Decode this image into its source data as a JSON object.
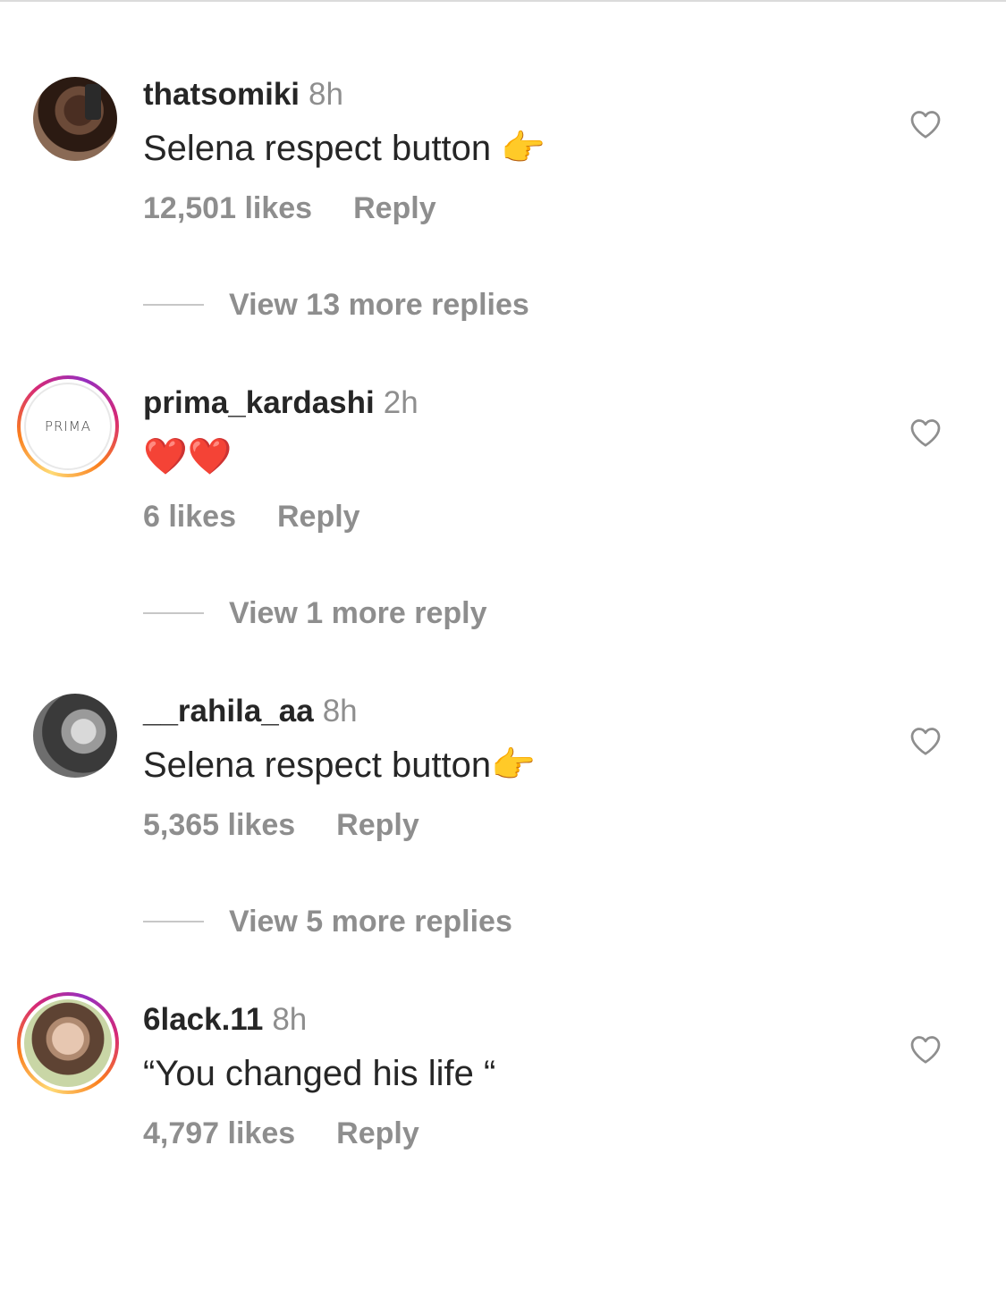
{
  "comments": [
    {
      "username": "thatsomiki",
      "time": "8h",
      "text": "Selena respect button 👉",
      "likes": "12,501 likes",
      "reply_label": "Reply",
      "view_replies": "View 13 more replies",
      "avatar": "profile-photo",
      "liked": false
    },
    {
      "username": "prima_kardashi",
      "time": "2h",
      "text": "❤️❤️",
      "likes": "6 likes",
      "reply_label": "Reply",
      "view_replies": "View 1 more reply",
      "avatar_text": "PRIMA",
      "story_ring": true,
      "liked": false
    },
    {
      "username": "__rahila_aa",
      "time": "8h",
      "text": "Selena respect button👉",
      "likes": "5,365 likes",
      "reply_label": "Reply",
      "view_replies": "View 5 more replies",
      "avatar": "profile-photo",
      "liked": false
    },
    {
      "username": "6lack.11",
      "time": "8h",
      "text": "“You changed his life “",
      "likes": "4,797 likes",
      "reply_label": "Reply",
      "avatar": "profile-photo",
      "story_ring": true,
      "liked": false
    }
  ],
  "colors": {
    "text_primary": "#262626",
    "text_secondary": "#8e8e8e",
    "divider": "#dbdbdb",
    "story_ring": [
      "#feda75",
      "#fa7e1e",
      "#d62976",
      "#962fbf"
    ]
  },
  "icons": {
    "like": "heart-outline-icon"
  }
}
